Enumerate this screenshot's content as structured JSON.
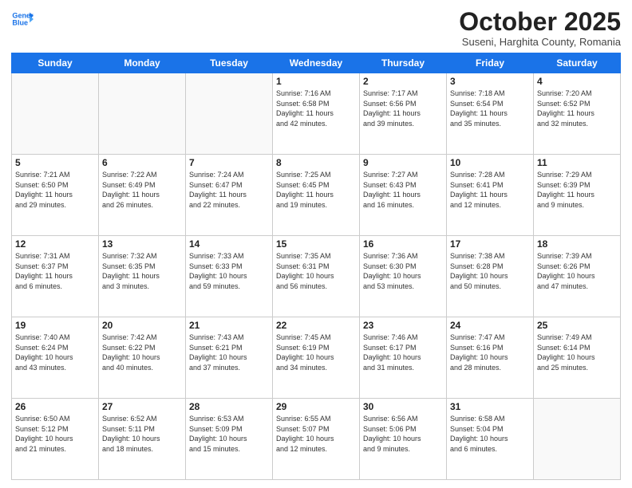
{
  "header": {
    "logo_line1": "General",
    "logo_line2": "Blue",
    "month": "October 2025",
    "location": "Suseni, Harghita County, Romania"
  },
  "days_of_week": [
    "Sunday",
    "Monday",
    "Tuesday",
    "Wednesday",
    "Thursday",
    "Friday",
    "Saturday"
  ],
  "weeks": [
    [
      {
        "day": "",
        "info": ""
      },
      {
        "day": "",
        "info": ""
      },
      {
        "day": "",
        "info": ""
      },
      {
        "day": "1",
        "info": "Sunrise: 7:16 AM\nSunset: 6:58 PM\nDaylight: 11 hours\nand 42 minutes."
      },
      {
        "day": "2",
        "info": "Sunrise: 7:17 AM\nSunset: 6:56 PM\nDaylight: 11 hours\nand 39 minutes."
      },
      {
        "day": "3",
        "info": "Sunrise: 7:18 AM\nSunset: 6:54 PM\nDaylight: 11 hours\nand 35 minutes."
      },
      {
        "day": "4",
        "info": "Sunrise: 7:20 AM\nSunset: 6:52 PM\nDaylight: 11 hours\nand 32 minutes."
      }
    ],
    [
      {
        "day": "5",
        "info": "Sunrise: 7:21 AM\nSunset: 6:50 PM\nDaylight: 11 hours\nand 29 minutes."
      },
      {
        "day": "6",
        "info": "Sunrise: 7:22 AM\nSunset: 6:49 PM\nDaylight: 11 hours\nand 26 minutes."
      },
      {
        "day": "7",
        "info": "Sunrise: 7:24 AM\nSunset: 6:47 PM\nDaylight: 11 hours\nand 22 minutes."
      },
      {
        "day": "8",
        "info": "Sunrise: 7:25 AM\nSunset: 6:45 PM\nDaylight: 11 hours\nand 19 minutes."
      },
      {
        "day": "9",
        "info": "Sunrise: 7:27 AM\nSunset: 6:43 PM\nDaylight: 11 hours\nand 16 minutes."
      },
      {
        "day": "10",
        "info": "Sunrise: 7:28 AM\nSunset: 6:41 PM\nDaylight: 11 hours\nand 12 minutes."
      },
      {
        "day": "11",
        "info": "Sunrise: 7:29 AM\nSunset: 6:39 PM\nDaylight: 11 hours\nand 9 minutes."
      }
    ],
    [
      {
        "day": "12",
        "info": "Sunrise: 7:31 AM\nSunset: 6:37 PM\nDaylight: 11 hours\nand 6 minutes."
      },
      {
        "day": "13",
        "info": "Sunrise: 7:32 AM\nSunset: 6:35 PM\nDaylight: 11 hours\nand 3 minutes."
      },
      {
        "day": "14",
        "info": "Sunrise: 7:33 AM\nSunset: 6:33 PM\nDaylight: 10 hours\nand 59 minutes."
      },
      {
        "day": "15",
        "info": "Sunrise: 7:35 AM\nSunset: 6:31 PM\nDaylight: 10 hours\nand 56 minutes."
      },
      {
        "day": "16",
        "info": "Sunrise: 7:36 AM\nSunset: 6:30 PM\nDaylight: 10 hours\nand 53 minutes."
      },
      {
        "day": "17",
        "info": "Sunrise: 7:38 AM\nSunset: 6:28 PM\nDaylight: 10 hours\nand 50 minutes."
      },
      {
        "day": "18",
        "info": "Sunrise: 7:39 AM\nSunset: 6:26 PM\nDaylight: 10 hours\nand 47 minutes."
      }
    ],
    [
      {
        "day": "19",
        "info": "Sunrise: 7:40 AM\nSunset: 6:24 PM\nDaylight: 10 hours\nand 43 minutes."
      },
      {
        "day": "20",
        "info": "Sunrise: 7:42 AM\nSunset: 6:22 PM\nDaylight: 10 hours\nand 40 minutes."
      },
      {
        "day": "21",
        "info": "Sunrise: 7:43 AM\nSunset: 6:21 PM\nDaylight: 10 hours\nand 37 minutes."
      },
      {
        "day": "22",
        "info": "Sunrise: 7:45 AM\nSunset: 6:19 PM\nDaylight: 10 hours\nand 34 minutes."
      },
      {
        "day": "23",
        "info": "Sunrise: 7:46 AM\nSunset: 6:17 PM\nDaylight: 10 hours\nand 31 minutes."
      },
      {
        "day": "24",
        "info": "Sunrise: 7:47 AM\nSunset: 6:16 PM\nDaylight: 10 hours\nand 28 minutes."
      },
      {
        "day": "25",
        "info": "Sunrise: 7:49 AM\nSunset: 6:14 PM\nDaylight: 10 hours\nand 25 minutes."
      }
    ],
    [
      {
        "day": "26",
        "info": "Sunrise: 6:50 AM\nSunset: 5:12 PM\nDaylight: 10 hours\nand 21 minutes."
      },
      {
        "day": "27",
        "info": "Sunrise: 6:52 AM\nSunset: 5:11 PM\nDaylight: 10 hours\nand 18 minutes."
      },
      {
        "day": "28",
        "info": "Sunrise: 6:53 AM\nSunset: 5:09 PM\nDaylight: 10 hours\nand 15 minutes."
      },
      {
        "day": "29",
        "info": "Sunrise: 6:55 AM\nSunset: 5:07 PM\nDaylight: 10 hours\nand 12 minutes."
      },
      {
        "day": "30",
        "info": "Sunrise: 6:56 AM\nSunset: 5:06 PM\nDaylight: 10 hours\nand 9 minutes."
      },
      {
        "day": "31",
        "info": "Sunrise: 6:58 AM\nSunset: 5:04 PM\nDaylight: 10 hours\nand 6 minutes."
      },
      {
        "day": "",
        "info": ""
      }
    ]
  ]
}
